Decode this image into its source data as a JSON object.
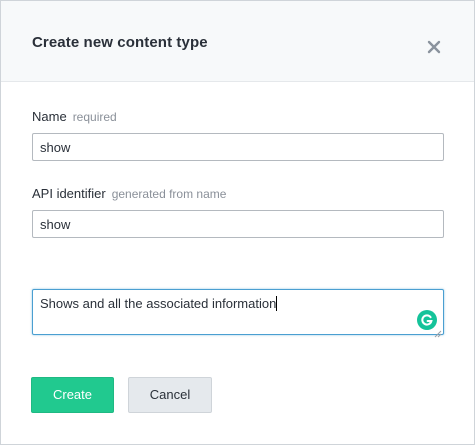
{
  "dialog": {
    "title": "Create new content type",
    "close_icon": "close-icon"
  },
  "name_field": {
    "label": "Name",
    "hint": "required",
    "value": "show"
  },
  "api_field": {
    "label": "API identifier",
    "hint": "generated from name",
    "value": "show"
  },
  "description_field": {
    "value": "Shows and all the associated information",
    "grammarly_icon": "grammarly-icon"
  },
  "actions": {
    "create_label": "Create",
    "cancel_label": "Cancel"
  },
  "colors": {
    "primary": "#21c98f",
    "focus": "#4a9fd1",
    "grammarly": "#15c39a"
  }
}
